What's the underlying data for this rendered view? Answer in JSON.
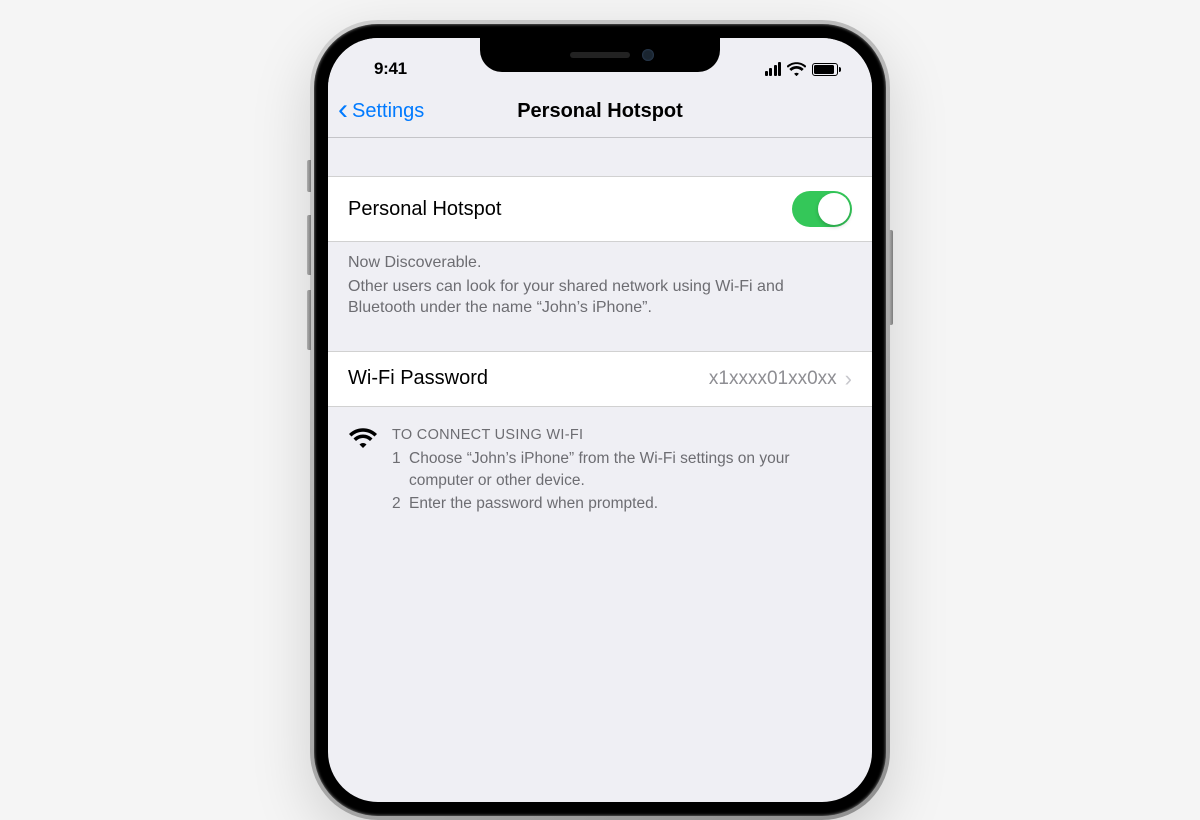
{
  "status": {
    "time": "9:41"
  },
  "nav": {
    "back_label": "Settings",
    "title": "Personal Hotspot"
  },
  "hotspot": {
    "label": "Personal Hotspot",
    "enabled": true
  },
  "footer1": {
    "line1": "Now Discoverable.",
    "line2": "Other users can look for your shared network using Wi-Fi and Bluetooth under the name “John’s iPhone”."
  },
  "wifi_password": {
    "label": "Wi-Fi Password",
    "value": "x1xxxx01xx0xx"
  },
  "instructions": {
    "wifi": {
      "title": "TO CONNECT USING WI-FI",
      "step1_num": "1",
      "step1_text": "Choose “John’s iPhone” from the Wi-Fi settings on your computer or other device.",
      "step2_num": "2",
      "step2_text": "Enter the password when prompted."
    }
  }
}
